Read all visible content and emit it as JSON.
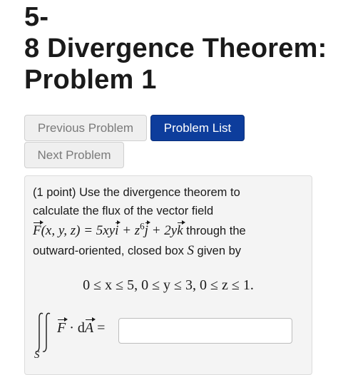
{
  "header": {
    "title_line1": "5-",
    "title_line2": "8 Divergence Theorem:",
    "title_line3": "Problem 1"
  },
  "nav": {
    "previous_label": "Previous Problem",
    "list_label": "Problem List",
    "next_label": "Next Problem"
  },
  "problem": {
    "intro_line1": "(1 point) Use the divergence theorem to",
    "intro_line2": "calculate the flux of the vector field",
    "field_F": "F",
    "field_args": "(x, y, z) = 5xy",
    "field_i": "i",
    "field_plus1": " + z",
    "field_exp": "6",
    "field_j": "j",
    "field_plus2": " + 2y",
    "field_k": "k",
    "field_through": " through the",
    "intro_line4a": "outward-oriented, closed box ",
    "intro_line4_S": "S",
    "intro_line4b": " given by",
    "bounds": "0 ≤ x ≤ 5,    0 ≤ y ≤ 3,    0 ≤ z ≤ 1.",
    "integral_sub": "S",
    "flux_F": "F",
    "flux_dot": " · d",
    "flux_A": "A",
    "flux_eq": " =",
    "answer_value": "",
    "answer_placeholder": ""
  },
  "colors": {
    "primary_button": "#0d3d9c",
    "disabled_button": "#efefef",
    "problem_background": "#f4f4f4"
  }
}
